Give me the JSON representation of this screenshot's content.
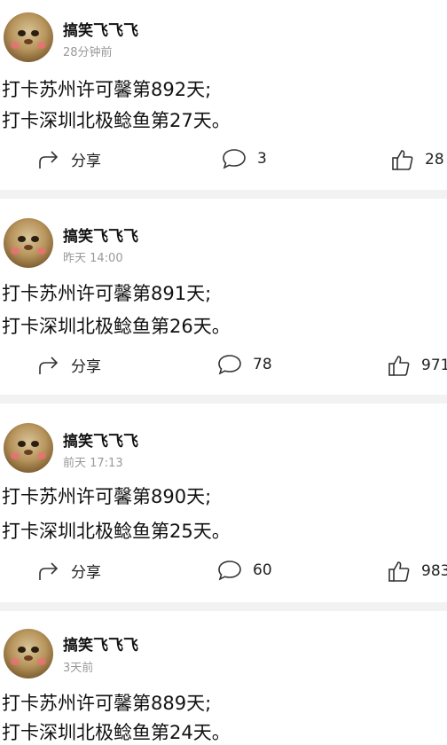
{
  "posts": [
    {
      "username": "搞笑飞飞飞",
      "time": "28分钟前",
      "lines": [
        "打卡苏州许可馨第892天;",
        "打卡深圳北极鲶鱼第27天。"
      ],
      "share_label": "分享",
      "comments": "3",
      "likes": "28"
    },
    {
      "username": "搞笑飞飞飞",
      "time": "昨天 14:00",
      "lines": [
        "打卡苏州许可馨第891天;",
        "打卡深圳北极鲶鱼第26天。"
      ],
      "share_label": "分享",
      "comments": "78",
      "likes": "971"
    },
    {
      "username": "搞笑飞飞飞",
      "time": "前天 17:13",
      "lines": [
        "打卡苏州许可馨第890天;",
        "打卡深圳北极鲶鱼第25天。"
      ],
      "share_label": "分享",
      "comments": "60",
      "likes": "983"
    },
    {
      "username": "搞笑飞飞飞",
      "time": "3天前",
      "lines": [
        "打卡苏州许可馨第889天;",
        "打卡深圳北极鲶鱼第24天。"
      ]
    }
  ],
  "icons": {
    "share": "share-arrow-icon",
    "comment": "comment-bubble-icon",
    "like": "thumbs-up-icon"
  },
  "colors": {
    "separator": "#f2f2f2",
    "secondary_text": "#999999"
  }
}
